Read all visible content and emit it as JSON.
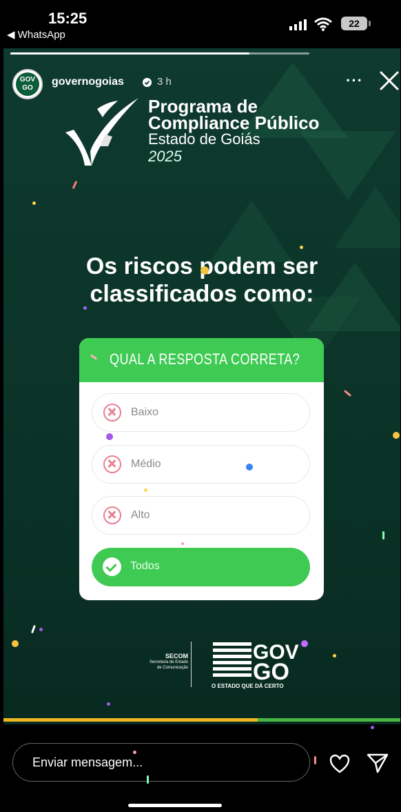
{
  "status_bar": {
    "time": "15:25",
    "back_app": "◀ WhatsApp",
    "battery": "22"
  },
  "story": {
    "progress": 0.8,
    "account": {
      "handle": "governogoias",
      "age": "3 h",
      "avatar_text": "GOV GO"
    },
    "program": {
      "title_line1": "Programa de",
      "title_line2": "Compliance Público",
      "subtitle": "Estado de Goiás",
      "year": "2025"
    },
    "headline_line1": "Os riscos podem ser",
    "headline_line2": "classificados como:",
    "quiz": {
      "question": "QUAL A RESPOSTA CORRETA?",
      "options": [
        {
          "label": "Baixo",
          "state": "wrong"
        },
        {
          "label": "Médio",
          "state": "wrong"
        },
        {
          "label": "Alto",
          "state": "wrong"
        },
        {
          "label": "Todos",
          "state": "correct"
        }
      ]
    },
    "footer": {
      "secom_title": "SECOM",
      "secom_line1": "Secretaria de Estado",
      "secom_line2": "de Comunicação",
      "govgo_tagline": "O ESTADO QUE DÁ CERTO"
    },
    "bottom_bar_fill": 0.64
  },
  "reply": {
    "placeholder": "Enviar mensagem..."
  },
  "colors": {
    "story_bg": "#0c3529",
    "quiz_green": "#3fca54",
    "wrong_pink": "#e87e92",
    "bar_yellow": "#f0b721",
    "bar_green": "#4bb743"
  },
  "icons": [
    "signal-icon",
    "wifi-icon",
    "battery-icon",
    "verified-badge-icon",
    "more-icon",
    "close-icon",
    "check-logo-icon",
    "x-circle-icon",
    "check-circle-icon",
    "heart-icon",
    "send-icon"
  ]
}
